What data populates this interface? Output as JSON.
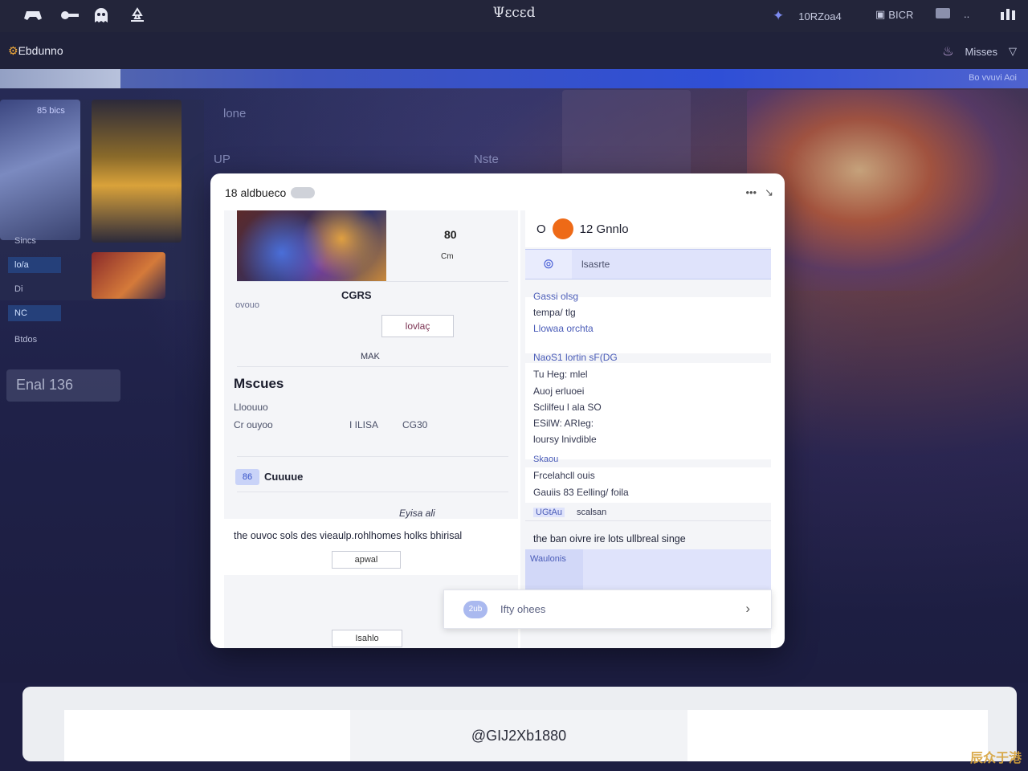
{
  "topbar": {
    "title": "Ψεcεd",
    "right": [
      {
        "icon": "globe-icon",
        "label": "10RZoa4"
      },
      {
        "icon": "briefcase-icon",
        "label": "BICR"
      },
      {
        "icon": "window-icon",
        "label": ""
      },
      {
        "icon": "more-icon",
        "label": ".."
      },
      {
        "icon": "stats-icon",
        "label": ""
      }
    ],
    "left_icons": [
      "controller-icon",
      "key-icon",
      "ghost-icon",
      "recycle-icon"
    ]
  },
  "subbar": {
    "brand": "Ebdunno",
    "right_label": "Misses",
    "right_icon": "heart-icon",
    "dropdown_icon": "chevron-down-icon"
  },
  "strip": {
    "right_text": "Bo vvuvi Aoi"
  },
  "background": {
    "labels": [
      "lone",
      "UP",
      "Nste"
    ],
    "left_badge": "85 bics",
    "left_items": [
      "Sincs",
      "lo/a",
      "Di",
      "NC",
      "Btdos"
    ],
    "left_pill": "Enal 136"
  },
  "dialog": {
    "title": "18 aldbueco",
    "left": {
      "stat_value": "80",
      "stat_unit": "Cm",
      "game_title": "CGRS",
      "row_label": "ovouo",
      "action_label": "lovlaç",
      "tag_text": "MAK",
      "section_heading": "Mscues",
      "line1": "Lloouuo",
      "line2_a": "Cr ouyoo",
      "line2_b": "I ILISA",
      "line2_c": "CG30",
      "badge": "86",
      "badge_label": "Cuuuue",
      "note_right": "Eyisa ali",
      "description": "the ouvoc sols des vieaulp.rohlhomes holks bhirisal",
      "small_button": "apwal",
      "bottom_button": "Isahlo"
    },
    "right": {
      "header_prefix": "O",
      "header_name": "12 Gnnlo",
      "selected_item": "lsasrte",
      "group1": [
        "Gassi olsg",
        "tempa/ tlg",
        "Llowaa orchta"
      ],
      "group2": [
        "NaoS1 lortin sF(DG",
        "Tu Heg: mlel",
        "Auoj erluoei",
        "Sclilfeu l ala SO",
        "ESilW: ARIeg:",
        "loursy lnivdible"
      ],
      "tag": "Skaou",
      "group3": [
        "Frcelahcll ouis",
        "Gauiis 83 Eelling/ foila"
      ],
      "chip": "UGtAu",
      "chip_label": "scalsan",
      "description": "the ban oivre ire lots ullbreal singe",
      "highlight_label": "Waulonis",
      "cta_bubble": "2ub",
      "cta_label": "Ifty ohees"
    }
  },
  "footer": {
    "code": "@GIJ2Xb1880",
    "watermark": "辰众于港"
  }
}
